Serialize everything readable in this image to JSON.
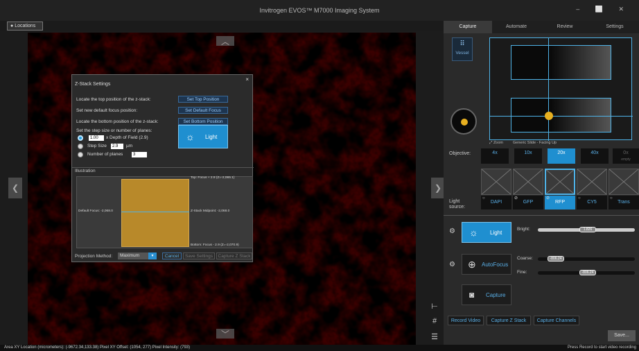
{
  "window": {
    "title": "Invitrogen EVOS™ M7000 Imaging System",
    "controls": "– ⬜ ✕"
  },
  "locations_tab": "Locations",
  "status": {
    "left": "Area XY Location (micrometers): (-9672.34,133.38)  Pixel XY Offset: (1054, 277)  Pixel Intensity: (793)",
    "right": "Press Record to start video recording"
  },
  "zstack": {
    "title": "Z-Stack Settings",
    "top_label": "Locate the top position of the z-stack:",
    "top_btn": "Set Top Position",
    "default_label": "Set new default focus position:",
    "default_btn": "Set Default Focus",
    "bottom_label": "Locate the bottom position of the z-stack:",
    "bottom_btn": "Set Bottom Position",
    "step_intro": "Set the step size or number of planes:",
    "opt1_value": "1.00",
    "opt1_label": "x Depth of Field (2.9)",
    "opt2_label": "Step Size",
    "opt2_value": "2.9",
    "opt2_unit": "µm",
    "opt3_label": "Number of planes",
    "opt3_value": "3",
    "light_btn": "Light",
    "illustration_title": "Illustration",
    "top_focus": "Top: Focus + 2.9 (Z=-2,065.1)",
    "default_focus": "Default Focus: -2,068.0",
    "midpoint": "Z-Stack Midpoint: -2,068.0",
    "bottom_focus": "Bottom: Focus - 2.9 (Z=-2,070.9)",
    "projection_label": "Projection Method:",
    "projection_value": "Maximum",
    "cancel": "Cancel",
    "save_settings": "Save Settings",
    "capture_z": "Capture Z Stack"
  },
  "right_panel": {
    "tabs": [
      "Capture",
      "Automate",
      "Review",
      "Settings"
    ],
    "vessel": "Vessel",
    "zoom": "Zoom",
    "slide": "Generic Slide - Facing Up",
    "objective_label": "Objective:",
    "objectives": [
      "4x",
      "10x",
      "20x",
      "40x",
      "0x"
    ],
    "objective_empty": "empty",
    "light_source_label": "Light source:",
    "channels": [
      "DAPI",
      "GFP",
      "RFP",
      "CY5",
      "Trans"
    ],
    "light_btn": "Light",
    "bright_label": "Bright:",
    "bright_value": "1.826",
    "autofocus_btn": "AutoFocus",
    "coarse_label": "Coarse:",
    "coarse_value": "-806.24",
    "fine_label": "Fine:",
    "fine_value": "-806.24",
    "capture_btn": "Capture",
    "record_video": "Record Video",
    "capture_z": "Capture Z Stack",
    "capture_channels": "Capture Channels",
    "save": "Save..."
  }
}
